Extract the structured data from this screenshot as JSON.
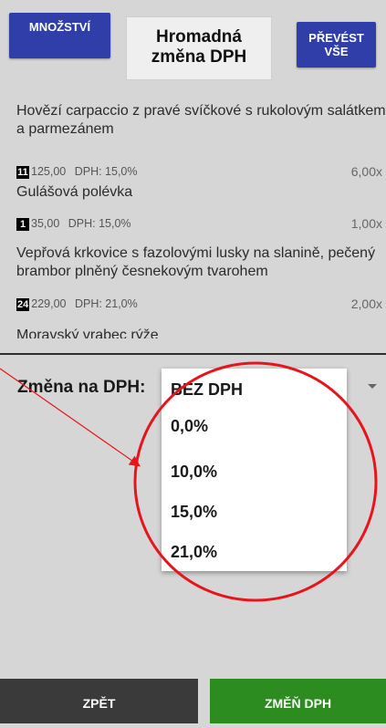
{
  "header": {
    "quantity_button": "MNOŽSTVÍ",
    "title_line1": "Hromadná",
    "title_line2": "změna DPH",
    "transfer_line1": "PŘEVÉST",
    "transfer_line2": "VŠE"
  },
  "items": [
    {
      "name": "Hovězí carpaccio z pravé svíčkové s rukolovým salátkem a parmezánem",
      "qty": "11",
      "price": "125,00",
      "vat": "DPH: 15,0%",
      "amount": "6,00x"
    },
    {
      "name": "Gulášová polévka",
      "qty": "1",
      "price": "35,00",
      "vat": "DPH: 15,0%",
      "amount": "1,00x"
    },
    {
      "name": "Vepřová krkovice s fazolovými lusky na slanině, pečený brambor plněný česnekovým tvarohem",
      "qty": "24",
      "price": "229,00",
      "vat": "DPH: 21,0%",
      "amount": "2,00x"
    },
    {
      "name": "Moravský vrabec rýže"
    }
  ],
  "vat_change": {
    "label": "Změna na DPH:",
    "options": [
      "BEZ DPH",
      "0,0%",
      "10,0%",
      "15,0%",
      "21,0%"
    ]
  },
  "footer": {
    "back": "ZPĚT",
    "apply": "ZMĚŇ DPH"
  },
  "colors": {
    "blue_button": "#2f3ea8",
    "green_button": "#2c8c1f",
    "dark_button": "#3a3a3a",
    "annotation_red": "#e8141c"
  }
}
